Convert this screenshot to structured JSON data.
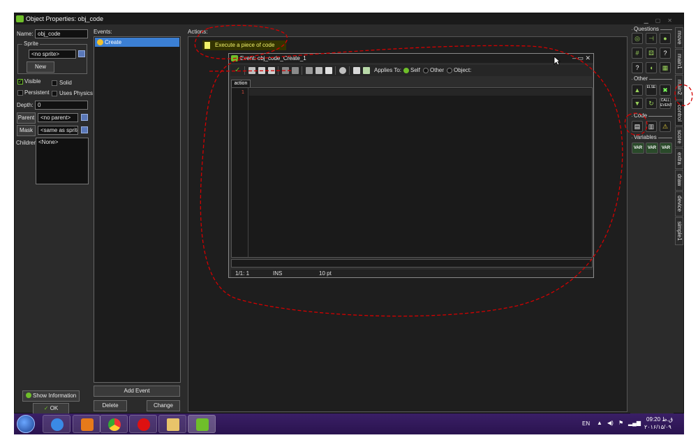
{
  "window": {
    "title": "Object Properties: obj_code"
  },
  "left_panel": {
    "name_label": "Name:",
    "name_value": "obj_code",
    "sprite_group": "Sprite",
    "sprite_value": "<no sprite>",
    "new_button": "New",
    "visible_label": "Visible",
    "solid_label": "Solid",
    "persistent_label": "Persistent",
    "physics_label": "Uses Physics",
    "depth_label": "Depth:",
    "depth_value": "0",
    "parent_button": "Parent",
    "parent_value": "<no parent>",
    "mask_button": "Mask",
    "mask_value": "<same as sprite>",
    "children_label": "Children:",
    "children_value": "<None>",
    "show_info_button": "Show Information",
    "ok_button": "OK"
  },
  "events_panel": {
    "label": "Events:",
    "items": [
      {
        "label": "Create"
      }
    ],
    "add_event_button": "Add Event",
    "delete_button": "Delete",
    "change_button": "Change"
  },
  "actions_panel": {
    "label": "Actions:",
    "items": [
      {
        "label": "Execute a piece of code"
      }
    ]
  },
  "editor": {
    "title": "Event: obj_code_Create_1",
    "applies_to_label": "Applies To:",
    "applies_options": [
      "Self",
      "Other",
      "Object:"
    ],
    "selected_option": "Self",
    "tab_label": "action",
    "line_numbers": [
      "1"
    ],
    "status": {
      "position": "1/1: 1",
      "mode": "INS",
      "font_size": "10 pt"
    }
  },
  "palette": {
    "groups": [
      "Questions",
      "Other",
      "Code",
      "Variables"
    ],
    "other_labels": [
      "ELSE",
      "CALL EVENT"
    ],
    "variable_labels": [
      "VAR",
      "VAR",
      "VAR"
    ],
    "tabs": [
      "move",
      "main1",
      "main2",
      "control",
      "score",
      "extra",
      "draw",
      "device",
      "simple1"
    ],
    "active_tab": "control"
  },
  "taskbar": {
    "language": "EN",
    "time": "09:20 ق.ظ",
    "date": "۲۰۱۶/۱۵/۰۹"
  },
  "colors": {
    "accent_green": "#6fbf2a",
    "selection_blue": "#3b7fd4",
    "annotation_red": "#d40000",
    "taskbar_purple": "#3a1f66"
  }
}
